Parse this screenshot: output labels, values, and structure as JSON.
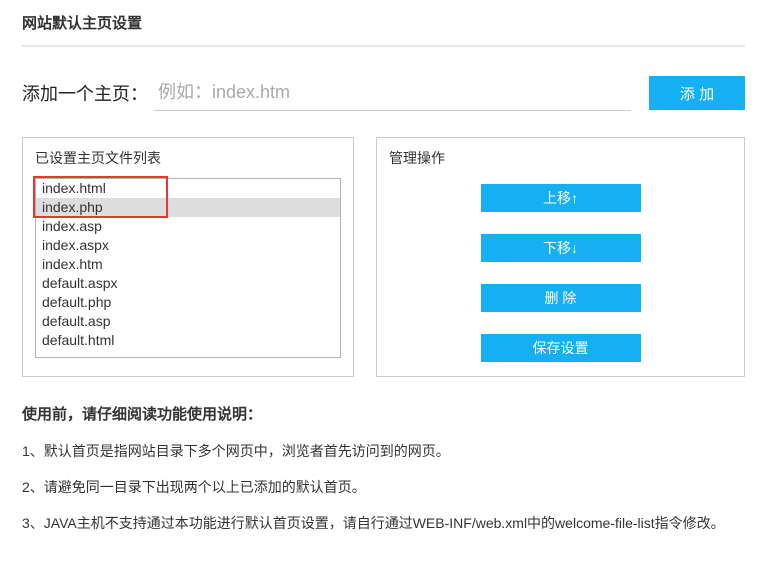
{
  "page_title": "网站默认主页设置",
  "add": {
    "label": "添加一个主页：",
    "placeholder": "例如：index.htm",
    "value": "",
    "button": "添 加"
  },
  "list_panel": {
    "title": "已设置主页文件列表",
    "items": [
      "index.html",
      "index.php",
      "index.asp",
      "index.aspx",
      "index.htm",
      "default.aspx",
      "default.php",
      "default.asp",
      "default.html"
    ],
    "selected_index": 1,
    "highlight_range": [
      0,
      1
    ]
  },
  "actions_panel": {
    "title": "管理操作",
    "move_up": "上移↑",
    "move_down": "下移↓",
    "delete": "删 除",
    "save": "保存设置"
  },
  "notes": {
    "title": "使用前，请仔细阅读功能使用说明：",
    "items": [
      "1、默认首页是指网站目录下多个网页中，浏览者首先访问到的网页。",
      "2、请避免同一目录下出现两个以上已添加的默认首页。",
      "3、JAVA主机不支持通过本功能进行默认首页设置，请自行通过WEB-INF/web.xml中的welcome-file-list指令修改。"
    ]
  }
}
